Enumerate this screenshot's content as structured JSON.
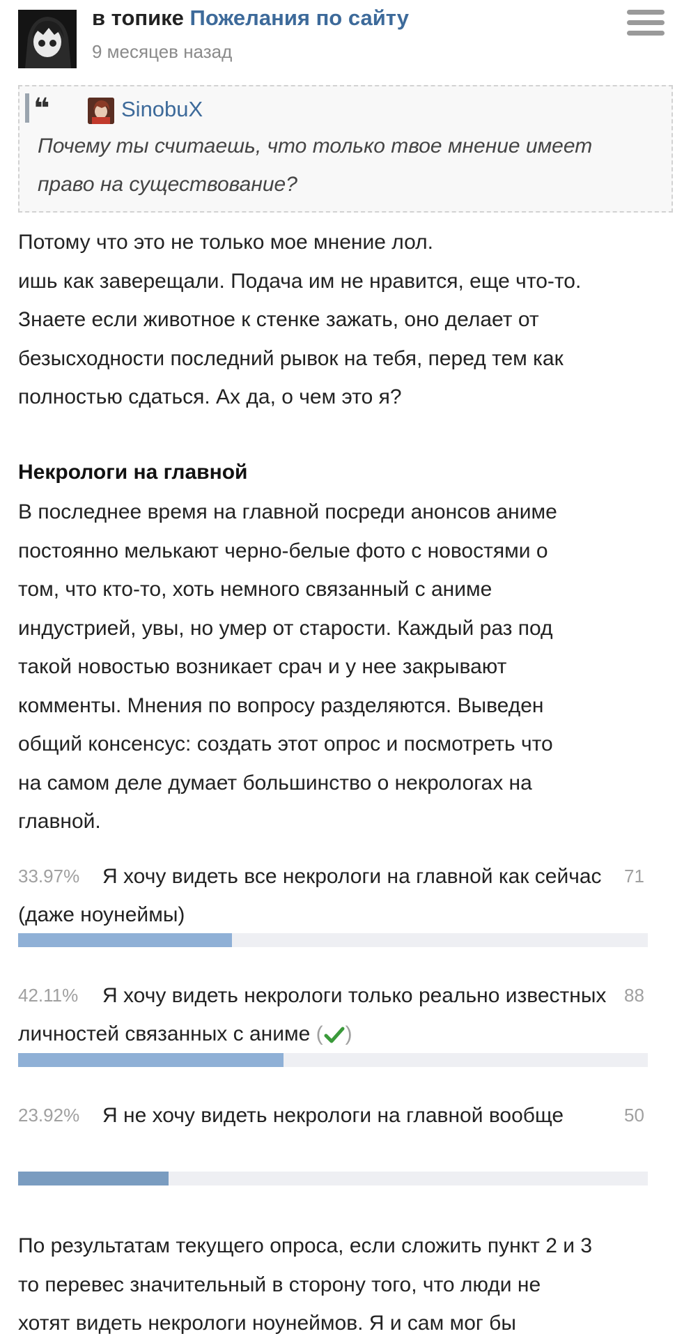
{
  "header": {
    "prefix": "в топике",
    "topic_link": "Пожелания по сайту",
    "time": "9 месяцев назад"
  },
  "quote": {
    "username": "SinobuX",
    "text": "Почему ты считаешь, что только твое мнение имеет право на существование?"
  },
  "body": {
    "lines": [
      "Потому что это не только мое мнение лол.",
      "ишь как заверещали. Подача им не нравится, еще что-то.",
      "Знаете если животное к стенке зажать, оно делает от",
      "безысходности последний рывок на тебя, перед тем как",
      "полностью сдаться. Ах да, о чем это я?"
    ]
  },
  "post": {
    "heading": "Некрологи на главной",
    "lines": [
      "В последнее время на главной посреди анонсов аниме",
      "постоянно мелькают черно-белые фото с новостями о",
      "том, что кто-то, хоть немного связанный с аниме",
      "индустрией, увы, но умер от старости. Каждый раз под",
      "такой новостью возникает срач и у нее закрывают",
      "комменты. Мнения по вопросу разделяются. Выведен",
      "общий консенсус: создать этот опрос и посмотреть что",
      "на самом деле думает большинство о некрологах на",
      "главной."
    ]
  },
  "poll": {
    "options": [
      {
        "percent": "33.97%",
        "text": "Я хочу видеть все некрологи на главной как сейчас (даже ноунеймы)",
        "count": "71",
        "fraction": 0.3397,
        "voted": false
      },
      {
        "percent": "42.11%",
        "text": "Я хочу видеть некрологи только реально известных личностей связанных с аниме",
        "count": "88",
        "fraction": 0.4211,
        "voted": true
      },
      {
        "percent": "23.92%",
        "text": "Я не хочу видеть некрологи на главной вообще",
        "count": "50",
        "fraction": 0.2392,
        "voted": false
      }
    ],
    "check_open": "(",
    "check_close": ")",
    "check_icon": "check-icon",
    "check_color": "#3a9a3a"
  },
  "footer": {
    "lines": [
      "По результатам текущего опроса, если сложить пункт 2 и 3",
      "то перевес значительный в сторону того, что люди не",
      "хотят видеть некрологи ноунеймов. Я и сам мог бы"
    ]
  }
}
